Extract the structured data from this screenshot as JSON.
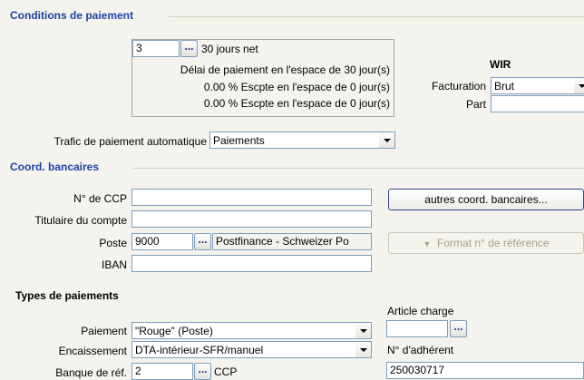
{
  "sections": {
    "payment_conditions": "Conditions de paiement",
    "bank_coords": "Coord. bancaires",
    "payment_types": "Types de paiements"
  },
  "payment_conditions": {
    "code_value": "3",
    "dots_label": "...",
    "code_description": "30 jours net",
    "line1": "Délai de paiement en l'espace de 30 jour(s)",
    "line2": "0.00 % Escpte en l'espace de 0 jour(s)",
    "line3": "0.00 % Escpte en l'espace de 0 jour(s)",
    "wir_title": "WIR",
    "billing_label": "Facturation",
    "billing_value": "Brut",
    "part_label": "Part",
    "part_value": "",
    "auto_traffic_label": "Trafic de paiement automatique",
    "auto_traffic_value": "Paiements"
  },
  "bank": {
    "ccp_label": "N° de CCP",
    "ccp_value": "",
    "holder_label": "Titulaire du compte",
    "holder_value": "",
    "post_label": "Poste",
    "post_code": "9000",
    "post_name": "Postfinance - Schweizer Po",
    "iban_label": "IBAN",
    "iban_value": "",
    "other_coords_button": "autres coord. bancaires...",
    "ref_format_button": "Format n° de référence"
  },
  "payment_types": {
    "payment_label": "Paiement",
    "payment_value": "\"Rouge\" (Poste)",
    "collection_label": "Encaissement",
    "collection_value": "DTA-intérieur-SFR/manuel",
    "ref_bank_label": "Banque de réf.",
    "ref_bank_code": "2",
    "ref_bank_name": "CCP",
    "article_charge_label": "Article charge",
    "article_charge_value": "",
    "member_no_label": "N° d'adhérent",
    "member_no_value": "250030717"
  }
}
